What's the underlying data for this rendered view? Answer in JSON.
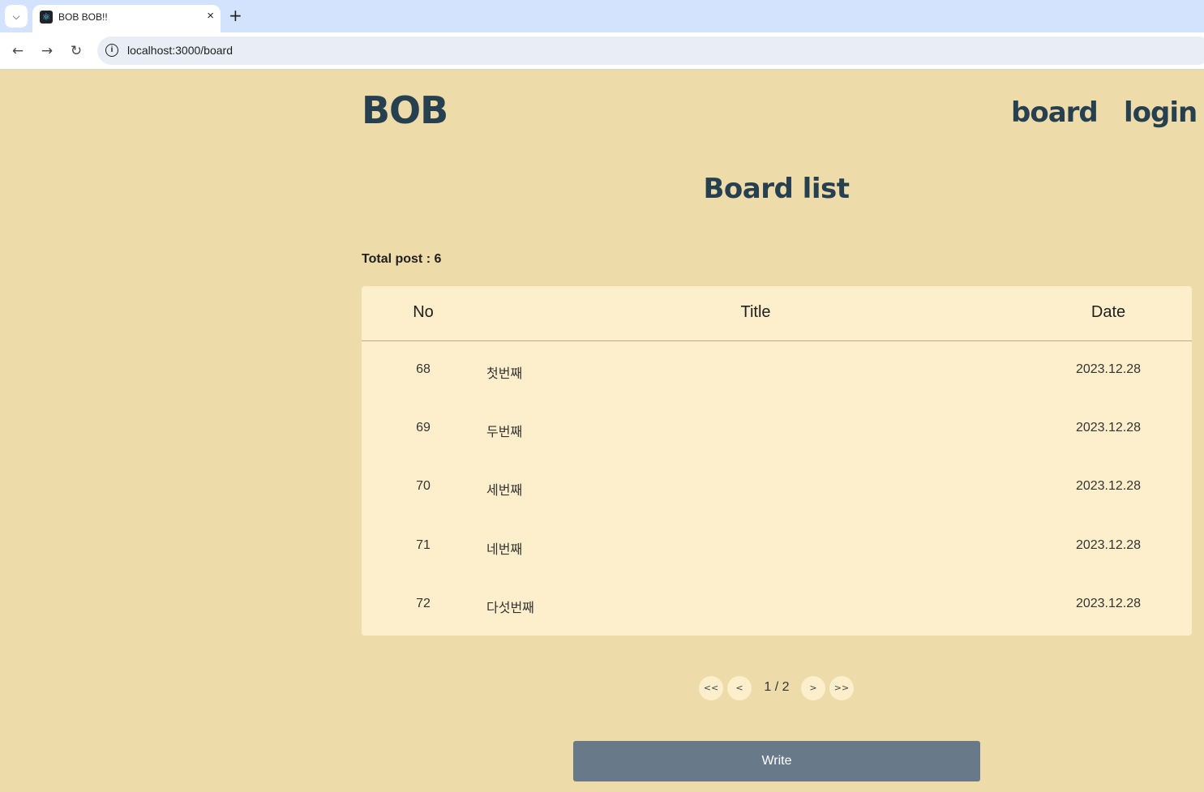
{
  "browser": {
    "tab_title": "BOB BOB!!",
    "tab_menu_icon": "chevron-down-icon",
    "close_icon": "×",
    "new_tab_icon": "+",
    "url": "localhost:3000/board",
    "back_icon": "←",
    "forward_icon": "→",
    "reload_icon": "↻",
    "info_icon": "i",
    "favicon_glyph": "⚛"
  },
  "header": {
    "logo": "BOB",
    "nav": [
      {
        "label": "board"
      },
      {
        "label": "login"
      }
    ]
  },
  "main": {
    "title": "Board list",
    "total_post": "Total post : 6",
    "columns": {
      "no": "No",
      "title": "Title",
      "date": "Date"
    },
    "rows": [
      {
        "no": "68",
        "title": "첫번째",
        "date": "2023.12.28"
      },
      {
        "no": "69",
        "title": "두번째",
        "date": "2023.12.28"
      },
      {
        "no": "70",
        "title": "세번째",
        "date": "2023.12.28"
      },
      {
        "no": "71",
        "title": "네번째",
        "date": "2023.12.28"
      },
      {
        "no": "72",
        "title": "다섯번째",
        "date": "2023.12.28"
      }
    ]
  },
  "pagination": {
    "first": "<<",
    "prev": "<",
    "current": "1 / 2",
    "next": ">",
    "last": ">>"
  },
  "write_button": "Write",
  "colors": {
    "background": "#eedbaa",
    "card": "#fdefcb",
    "brand": "#274050",
    "button": "#687a89"
  }
}
